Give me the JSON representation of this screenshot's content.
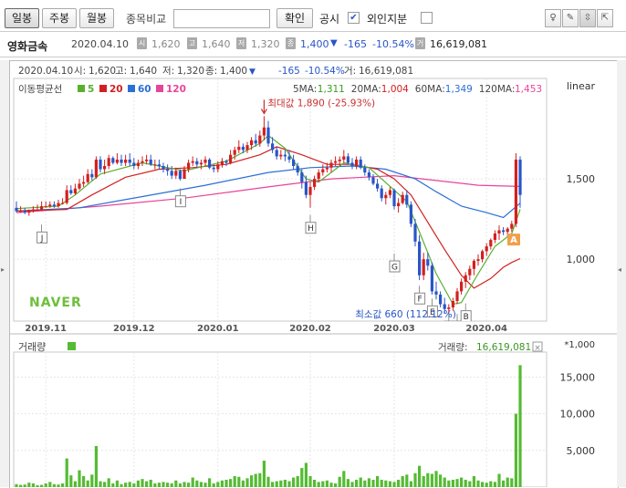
{
  "toolbar": {
    "tabs": [
      "일봉",
      "주봉",
      "월봉"
    ],
    "compare_label": "종목비교",
    "compare_value": "",
    "confirm_label": "확인",
    "notice_label": "공시",
    "foreign_label": "외인지분"
  },
  "infobar": {
    "name": "영화금속",
    "date": "2020.04.10",
    "open": "1,620",
    "high": "1,640",
    "low": "1,320",
    "close": "1,400",
    "change": "-165",
    "change_pct": "-10.54%",
    "volume": "16,619,081",
    "down_mark": "▼"
  },
  "chart_data": [
    {
      "type": "candlestick",
      "header": {
        "date": "2020.04.10",
        "open_label": "시:",
        "open": "1,620",
        "high_label": "고:",
        "high": "1,640",
        "low_label": "저:",
        "low": "1,320",
        "close_label": "종:",
        "close": "1,400",
        "down_mark": "▼",
        "change": "-165",
        "change_pct": "-10.54%",
        "volume_label": "거:",
        "volume": "16,619,081"
      },
      "scale_label": "linear",
      "legend_title": "이동평균선",
      "ma_legend": [
        {
          "period": "5",
          "color": "#58b030"
        },
        {
          "period": "20",
          "color": "#d22020"
        },
        {
          "period": "60",
          "color": "#2a6fd6"
        },
        {
          "period": "120",
          "color": "#e8449a"
        }
      ],
      "ma_values": [
        {
          "label": "5MA:",
          "value": "1,311",
          "color": "#3a9a20"
        },
        {
          "label": "20MA:",
          "value": "1,004",
          "color": "#d22020"
        },
        {
          "label": "60MA:",
          "value": "1,349",
          "color": "#2a6fd6"
        },
        {
          "label": "120MA:",
          "value": "1,453",
          "color": "#e8449a"
        }
      ],
      "max_annotation": "최대값 1,890 (-25.93%)",
      "min_annotation": "최소값 660 (112.12%)",
      "watermark": "NAVER",
      "y_ticks": [
        {
          "value": 1000,
          "label": "1,000"
        },
        {
          "value": 1500,
          "label": "1,500"
        }
      ],
      "y_range": [
        615,
        2125
      ],
      "x_labels": [
        {
          "index": 7,
          "label": "2019.11"
        },
        {
          "index": 28,
          "label": "2019.12"
        },
        {
          "index": 48,
          "label": "2020.01"
        },
        {
          "index": 70,
          "label": "2020.02"
        },
        {
          "index": 90,
          "label": "2020.03"
        },
        {
          "index": 112,
          "label": "2020.04"
        }
      ],
      "markers": [
        {
          "index": 6,
          "label": "J",
          "value": 1215
        },
        {
          "index": 39,
          "label": "I",
          "value": 1440
        },
        {
          "index": 70,
          "label": "H",
          "value": 1275
        },
        {
          "index": 90,
          "label": "G",
          "value": 1035
        },
        {
          "index": 96,
          "label": "F",
          "value": 835
        },
        {
          "index": 99,
          "label": "E",
          "value": 755
        },
        {
          "index": 103,
          "label": "D",
          "value": 660
        },
        {
          "index": 105,
          "label": "C",
          "value": 660
        },
        {
          "index": 107,
          "label": "B",
          "value": 725
        }
      ],
      "signal_badge": {
        "label": "A",
        "value": 1125
      },
      "candles": [
        [
          1320,
          1360,
          1290,
          1300
        ],
        [
          1300,
          1330,
          1290,
          1300
        ],
        [
          1300,
          1320,
          1280,
          1290
        ],
        [
          1290,
          1310,
          1270,
          1300
        ],
        [
          1300,
          1330,
          1290,
          1310
        ],
        [
          1310,
          1340,
          1300,
          1310
        ],
        [
          1310,
          1360,
          1300,
          1330
        ],
        [
          1330,
          1360,
          1320,
          1330
        ],
        [
          1330,
          1360,
          1320,
          1340
        ],
        [
          1340,
          1360,
          1320,
          1330
        ],
        [
          1330,
          1370,
          1320,
          1350
        ],
        [
          1350,
          1380,
          1340,
          1350
        ],
        [
          1350,
          1460,
          1340,
          1430
        ],
        [
          1430,
          1460,
          1400,
          1410
        ],
        [
          1410,
          1470,
          1400,
          1440
        ],
        [
          1440,
          1500,
          1430,
          1470
        ],
        [
          1470,
          1520,
          1450,
          1480
        ],
        [
          1480,
          1560,
          1470,
          1530
        ],
        [
          1530,
          1560,
          1490,
          1510
        ],
        [
          1510,
          1640,
          1500,
          1620
        ],
        [
          1620,
          1640,
          1540,
          1560
        ],
        [
          1560,
          1620,
          1530,
          1580
        ],
        [
          1580,
          1650,
          1560,
          1630
        ],
        [
          1630,
          1640,
          1590,
          1600
        ],
        [
          1600,
          1660,
          1590,
          1620
        ],
        [
          1620,
          1650,
          1580,
          1600
        ],
        [
          1600,
          1650,
          1580,
          1620
        ],
        [
          1620,
          1660,
          1580,
          1600
        ],
        [
          1600,
          1630,
          1560,
          1580
        ],
        [
          1580,
          1620,
          1560,
          1600
        ],
        [
          1600,
          1640,
          1580,
          1610
        ],
        [
          1610,
          1650,
          1590,
          1620
        ],
        [
          1620,
          1650,
          1580,
          1590
        ],
        [
          1590,
          1620,
          1560,
          1590
        ],
        [
          1590,
          1620,
          1560,
          1580
        ],
        [
          1580,
          1600,
          1540,
          1560
        ],
        [
          1560,
          1590,
          1520,
          1550
        ],
        [
          1550,
          1580,
          1500,
          1520
        ],
        [
          1520,
          1570,
          1500,
          1550
        ],
        [
          1550,
          1560,
          1490,
          1500
        ],
        [
          1500,
          1580,
          1500,
          1560
        ],
        [
          1560,
          1620,
          1540,
          1600
        ],
        [
          1600,
          1640,
          1580,
          1610
        ],
        [
          1610,
          1630,
          1570,
          1590
        ],
        [
          1590,
          1620,
          1560,
          1600
        ],
        [
          1600,
          1640,
          1580,
          1620
        ],
        [
          1620,
          1630,
          1560,
          1570
        ],
        [
          1570,
          1590,
          1540,
          1560
        ],
        [
          1560,
          1610,
          1540,
          1590
        ],
        [
          1590,
          1630,
          1570,
          1610
        ],
        [
          1610,
          1620,
          1580,
          1600
        ],
        [
          1600,
          1680,
          1590,
          1650
        ],
        [
          1650,
          1700,
          1620,
          1680
        ],
        [
          1680,
          1740,
          1660,
          1700
        ],
        [
          1700,
          1720,
          1660,
          1680
        ],
        [
          1680,
          1730,
          1660,
          1710
        ],
        [
          1710,
          1760,
          1680,
          1740
        ],
        [
          1740,
          1780,
          1700,
          1720
        ],
        [
          1720,
          1800,
          1700,
          1770
        ],
        [
          1770,
          1890,
          1740,
          1820
        ],
        [
          1820,
          1860,
          1700,
          1720
        ],
        [
          1720,
          1760,
          1660,
          1680
        ],
        [
          1680,
          1700,
          1620,
          1640
        ],
        [
          1640,
          1680,
          1620,
          1650
        ],
        [
          1650,
          1680,
          1610,
          1640
        ],
        [
          1640,
          1680,
          1600,
          1620
        ],
        [
          1620,
          1650,
          1560,
          1580
        ],
        [
          1580,
          1600,
          1520,
          1540
        ],
        [
          1540,
          1560,
          1440,
          1480
        ],
        [
          1480,
          1520,
          1380,
          1400
        ],
        [
          1400,
          1480,
          1320,
          1450
        ],
        [
          1450,
          1520,
          1430,
          1500
        ],
        [
          1500,
          1560,
          1480,
          1540
        ],
        [
          1540,
          1590,
          1520,
          1560
        ],
        [
          1560,
          1600,
          1540,
          1570
        ],
        [
          1570,
          1620,
          1540,
          1600
        ],
        [
          1600,
          1640,
          1580,
          1610
        ],
        [
          1610,
          1640,
          1580,
          1620
        ],
        [
          1620,
          1680,
          1600,
          1640
        ],
        [
          1640,
          1660,
          1590,
          1600
        ],
        [
          1600,
          1630,
          1560,
          1580
        ],
        [
          1580,
          1640,
          1560,
          1620
        ],
        [
          1620,
          1640,
          1560,
          1570
        ],
        [
          1570,
          1590,
          1520,
          1540
        ],
        [
          1540,
          1560,
          1490,
          1510
        ],
        [
          1510,
          1530,
          1460,
          1470
        ],
        [
          1470,
          1500,
          1420,
          1440
        ],
        [
          1440,
          1460,
          1360,
          1380
        ],
        [
          1380,
          1420,
          1340,
          1400
        ],
        [
          1400,
          1450,
          1380,
          1430
        ],
        [
          1430,
          1440,
          1310,
          1330
        ],
        [
          1330,
          1380,
          1290,
          1350
        ],
        [
          1350,
          1420,
          1340,
          1400
        ],
        [
          1400,
          1430,
          1320,
          1340
        ],
        [
          1340,
          1360,
          1200,
          1220
        ],
        [
          1220,
          1250,
          1080,
          1110
        ],
        [
          1110,
          1150,
          870,
          900
        ],
        [
          900,
          1040,
          870,
          1000
        ],
        [
          1000,
          1040,
          930,
          960
        ],
        [
          960,
          980,
          780,
          800
        ],
        [
          800,
          860,
          750,
          780
        ],
        [
          780,
          800,
          700,
          720
        ],
        [
          720,
          760,
          660,
          690
        ],
        [
          690,
          720,
          660,
          700
        ],
        [
          700,
          760,
          680,
          740
        ],
        [
          740,
          820,
          720,
          800
        ],
        [
          800,
          880,
          780,
          860
        ],
        [
          860,
          920,
          820,
          900
        ],
        [
          900,
          960,
          870,
          940
        ],
        [
          940,
          1000,
          900,
          990
        ],
        [
          990,
          1030,
          960,
          1000
        ],
        [
          1000,
          1060,
          980,
          1050
        ],
        [
          1050,
          1100,
          1020,
          1080
        ],
        [
          1080,
          1130,
          1060,
          1120
        ],
        [
          1120,
          1180,
          1100,
          1160
        ],
        [
          1160,
          1210,
          1120,
          1180
        ],
        [
          1180,
          1200,
          1150,
          1170
        ],
        [
          1170,
          1200,
          1140,
          1190
        ],
        [
          1190,
          1240,
          1170,
          1220
        ],
        [
          1220,
          1660,
          1200,
          1620
        ],
        [
          1620,
          1640,
          1320,
          1400
        ]
      ],
      "ma5": [
        [
          0,
          1315
        ],
        [
          10,
          1330
        ],
        [
          14,
          1400
        ],
        [
          20,
          1530
        ],
        [
          30,
          1600
        ],
        [
          40,
          1550
        ],
        [
          50,
          1610
        ],
        [
          58,
          1720
        ],
        [
          60,
          1770
        ],
        [
          64,
          1690
        ],
        [
          69,
          1500
        ],
        [
          72,
          1480
        ],
        [
          78,
          1600
        ],
        [
          84,
          1570
        ],
        [
          90,
          1430
        ],
        [
          93,
          1360
        ],
        [
          96,
          1170
        ],
        [
          100,
          910
        ],
        [
          104,
          720
        ],
        [
          106,
          730
        ],
        [
          110,
          910
        ],
        [
          114,
          1080
        ],
        [
          118,
          1160
        ],
        [
          120,
          1311
        ]
      ],
      "ma20": [
        [
          0,
          1300
        ],
        [
          12,
          1310
        ],
        [
          18,
          1400
        ],
        [
          26,
          1510
        ],
        [
          34,
          1560
        ],
        [
          42,
          1570
        ],
        [
          50,
          1590
        ],
        [
          58,
          1650
        ],
        [
          62,
          1700
        ],
        [
          68,
          1650
        ],
        [
          74,
          1590
        ],
        [
          80,
          1590
        ],
        [
          86,
          1560
        ],
        [
          90,
          1500
        ],
        [
          94,
          1400
        ],
        [
          98,
          1230
        ],
        [
          102,
          1060
        ],
        [
          106,
          900
        ],
        [
          109,
          820
        ],
        [
          113,
          880
        ],
        [
          116,
          950
        ],
        [
          118,
          980
        ],
        [
          120,
          1004
        ]
      ],
      "ma60": [
        [
          0,
          1300
        ],
        [
          15,
          1320
        ],
        [
          30,
          1390
        ],
        [
          45,
          1460
        ],
        [
          60,
          1540
        ],
        [
          70,
          1570
        ],
        [
          80,
          1580
        ],
        [
          88,
          1560
        ],
        [
          95,
          1500
        ],
        [
          100,
          1420
        ],
        [
          106,
          1330
        ],
        [
          112,
          1290
        ],
        [
          116,
          1260
        ],
        [
          120,
          1349
        ]
      ],
      "ma120": [
        [
          0,
          1290
        ],
        [
          20,
          1330
        ],
        [
          40,
          1380
        ],
        [
          60,
          1450
        ],
        [
          75,
          1500
        ],
        [
          90,
          1520
        ],
        [
          100,
          1490
        ],
        [
          110,
          1460
        ],
        [
          120,
          1453
        ]
      ],
      "volume": {
        "title": "거래량",
        "legend_color": "#55bb33",
        "last_label": "거래량:",
        "last_value": "16,619,081",
        "unit_label": "*1,000",
        "y_ticks": [
          {
            "value": 5000,
            "label": "5,000"
          },
          {
            "value": 10000,
            "label": "10,000"
          },
          {
            "value": 15000,
            "label": "15,000"
          }
        ],
        "y_range": [
          0,
          18400
        ],
        "values": [
          400,
          300,
          350,
          600,
          500,
          250,
          300,
          500,
          700,
          400,
          350,
          500,
          3900,
          1600,
          800,
          2300,
          1500,
          900,
          1700,
          5600,
          800,
          700,
          1200,
          500,
          900,
          400,
          600,
          700,
          500,
          900,
          1100,
          800,
          1000,
          500,
          600,
          700,
          600,
          500,
          900,
          500,
          700,
          600,
          1300,
          900,
          700,
          600,
          1200,
          500,
          700,
          900,
          1000,
          1100,
          1500,
          1400,
          900,
          1200,
          1600,
          1800,
          1900,
          3600,
          1400,
          700,
          800,
          900,
          1000,
          800,
          1300,
          1500,
          2600,
          3300,
          1500,
          1000,
          700,
          800,
          900,
          600,
          500,
          1400,
          2200,
          1100,
          700,
          1000,
          1300,
          900,
          1200,
          1000,
          1500,
          1000,
          900,
          800,
          700,
          1000,
          1500,
          1700,
          800,
          1900,
          2900,
          1500,
          1900,
          1800,
          2200,
          1700,
          1300,
          900,
          1000,
          1100,
          1300,
          1000,
          800,
          1500,
          900,
          700,
          600,
          800,
          700,
          1800,
          900,
          1300,
          1200,
          10000,
          16619
        ]
      }
    }
  ]
}
